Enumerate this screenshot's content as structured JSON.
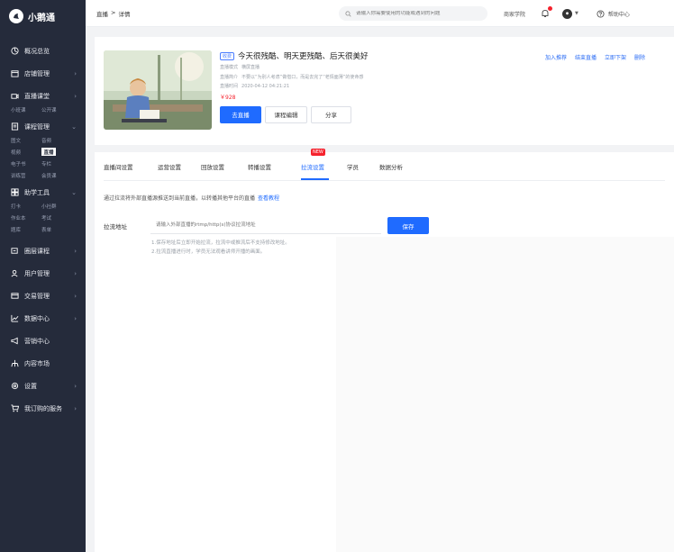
{
  "sidebar": {
    "logo_text": "小鹅通",
    "items": {
      "overview": "概况总览",
      "shop": "店铺管理",
      "live": "直播课堂",
      "course": "课程管理",
      "assist": "助学工具",
      "circle": "圈层课程",
      "user": "用户管理",
      "trade": "交易管理",
      "data": "数据中心",
      "marketing": "营销中心",
      "content_market": "内容市场",
      "settings": "设置",
      "ordered_services": "我订购的服务"
    },
    "live_sub": [
      "小班课",
      "公开课"
    ],
    "course_sub": [
      "图文",
      "音频",
      "视频",
      "直播",
      "电子书",
      "专栏",
      "训练营",
      "会员课"
    ],
    "assist_sub": [
      "打卡",
      "小社群",
      "作业本",
      "考试",
      "题库",
      "表单"
    ]
  },
  "header": {
    "breadcrumb_root": "直播",
    "breadcrumb_sep": ">",
    "breadcrumb_current": "详情",
    "search_placeholder": "请输入你需要使用的功能或遇到的问题",
    "merchant_school": "商家学院",
    "help_center": "帮助中心"
  },
  "course": {
    "tag": "收费",
    "title": "今天很残酷、明天更残酷、后天很美好",
    "meta_mode_key": "直播模式",
    "meta_mode_value": "横屏直播",
    "meta_intro_key": "直播简介",
    "meta_intro_value": "不要以“为别人考虑”做借口，而是去完了“老情面薄”的使命感",
    "meta_time_key": "直播时间",
    "meta_time_value": "2020-04-12 04:21:21",
    "price": "￥928"
  },
  "buttons": {
    "go_live": "去直播",
    "edit_course": "课程编辑",
    "share": "分享",
    "save": "保存"
  },
  "actions": [
    "加入推荐",
    "结束直播",
    "立即下架",
    "删除"
  ],
  "tabs": [
    "直播间设置",
    "运营设置",
    "回放设置",
    "转播设置",
    "拉流设置",
    "学员",
    "数据分析"
  ],
  "tab_badge": "NEW",
  "pull_settings": {
    "tip": "通过拉流将外部直播源推送到当前直播，以转播其他平台的直播",
    "tip_link": "查看教程",
    "label": "拉流地址",
    "input_placeholder": "请输入外部直播的rtmp/http(s)协议拉流地址",
    "notes": [
      "1.保存地址后立即开始拉流，拉流中或推流后不支持修改地址。",
      "2.拉流直播进行时，学员无法观看讲师开播的画面。"
    ]
  },
  "colors": {
    "sidebar_bg": "#252b3b",
    "primary": "#1f6bff",
    "danger": "#f5222d"
  }
}
